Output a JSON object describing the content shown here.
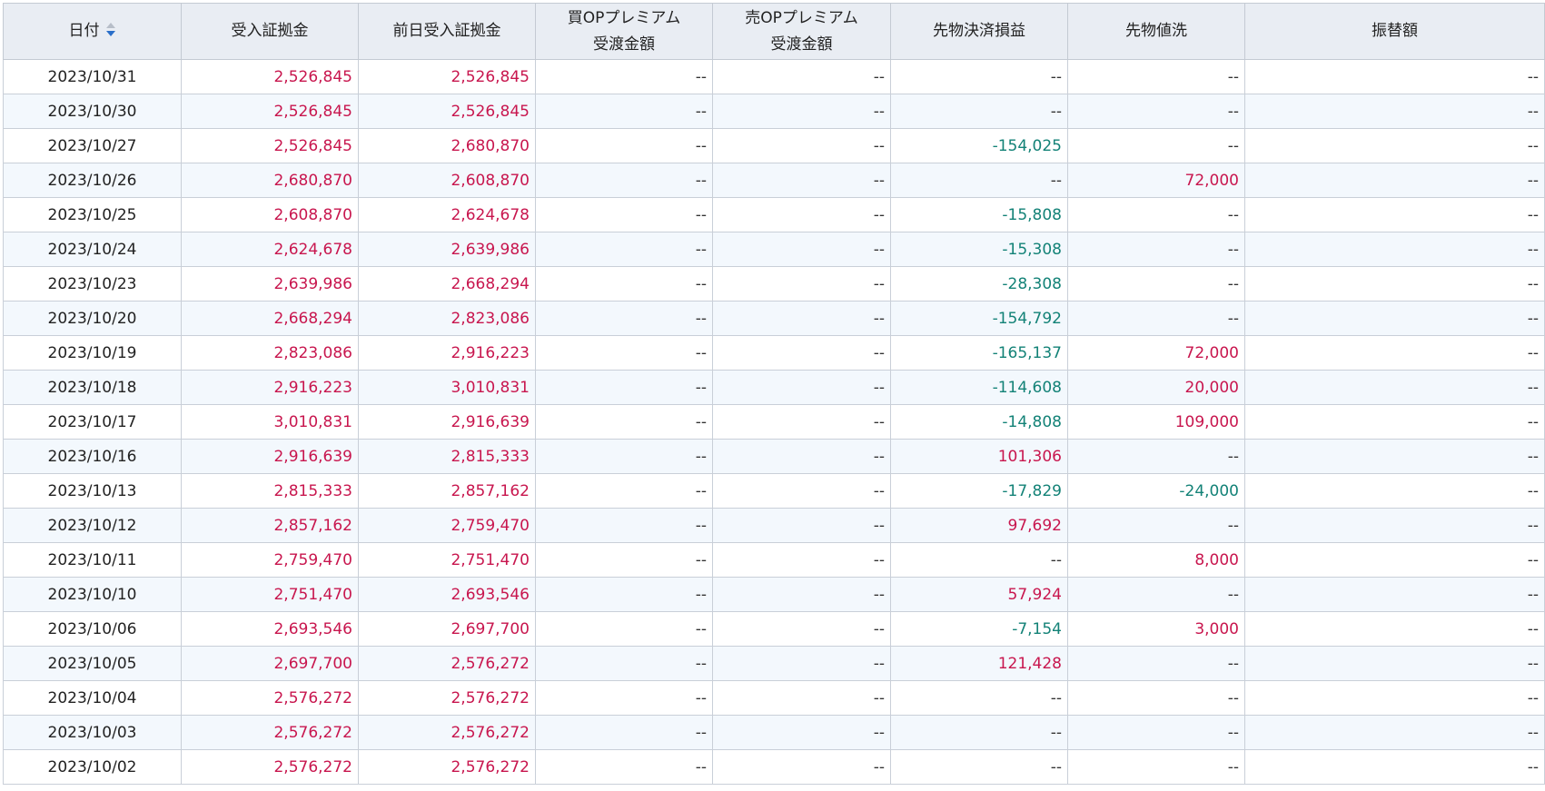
{
  "colors": {
    "positive": "#c8164e",
    "negative": "#138277",
    "header_bg": "#e9edf3",
    "stripe_bg": "#f3f8fd"
  },
  "sort_icon": "sort-descending-icon",
  "columns": [
    {
      "key": "date",
      "line1": "日付",
      "line2": ""
    },
    {
      "key": "margin",
      "line1": "受入証拠金",
      "line2": ""
    },
    {
      "key": "prev_margin",
      "line1": "前日受入証拠金",
      "line2": ""
    },
    {
      "key": "buy_op",
      "line1": "買OPプレミアム",
      "line2": "受渡金額"
    },
    {
      "key": "sell_op",
      "line1": "売OPプレミアム",
      "line2": "受渡金額"
    },
    {
      "key": "futures_pl",
      "line1": "先物決済損益",
      "line2": ""
    },
    {
      "key": "futures_mtm",
      "line1": "先物値洗",
      "line2": ""
    },
    {
      "key": "transfer",
      "line1": "振替額",
      "line2": ""
    }
  ],
  "rows": [
    [
      "2023/10/31",
      "2,526,845",
      "2,526,845",
      "--",
      "--",
      "--",
      "--",
      "--"
    ],
    [
      "2023/10/30",
      "2,526,845",
      "2,526,845",
      "--",
      "--",
      "--",
      "--",
      "--"
    ],
    [
      "2023/10/27",
      "2,526,845",
      "2,680,870",
      "--",
      "--",
      "-154,025",
      "--",
      "--"
    ],
    [
      "2023/10/26",
      "2,680,870",
      "2,608,870",
      "--",
      "--",
      "--",
      "72,000",
      "--"
    ],
    [
      "2023/10/25",
      "2,608,870",
      "2,624,678",
      "--",
      "--",
      "-15,808",
      "--",
      "--"
    ],
    [
      "2023/10/24",
      "2,624,678",
      "2,639,986",
      "--",
      "--",
      "-15,308",
      "--",
      "--"
    ],
    [
      "2023/10/23",
      "2,639,986",
      "2,668,294",
      "--",
      "--",
      "-28,308",
      "--",
      "--"
    ],
    [
      "2023/10/20",
      "2,668,294",
      "2,823,086",
      "--",
      "--",
      "-154,792",
      "--",
      "--"
    ],
    [
      "2023/10/19",
      "2,823,086",
      "2,916,223",
      "--",
      "--",
      "-165,137",
      "72,000",
      "--"
    ],
    [
      "2023/10/18",
      "2,916,223",
      "3,010,831",
      "--",
      "--",
      "-114,608",
      "20,000",
      "--"
    ],
    [
      "2023/10/17",
      "3,010,831",
      "2,916,639",
      "--",
      "--",
      "-14,808",
      "109,000",
      "--"
    ],
    [
      "2023/10/16",
      "2,916,639",
      "2,815,333",
      "--",
      "--",
      "101,306",
      "--",
      "--"
    ],
    [
      "2023/10/13",
      "2,815,333",
      "2,857,162",
      "--",
      "--",
      "-17,829",
      "-24,000",
      "--"
    ],
    [
      "2023/10/12",
      "2,857,162",
      "2,759,470",
      "--",
      "--",
      "97,692",
      "--",
      "--"
    ],
    [
      "2023/10/11",
      "2,759,470",
      "2,751,470",
      "--",
      "--",
      "--",
      "8,000",
      "--"
    ],
    [
      "2023/10/10",
      "2,751,470",
      "2,693,546",
      "--",
      "--",
      "57,924",
      "--",
      "--"
    ],
    [
      "2023/10/06",
      "2,693,546",
      "2,697,700",
      "--",
      "--",
      "-7,154",
      "3,000",
      "--"
    ],
    [
      "2023/10/05",
      "2,697,700",
      "2,576,272",
      "--",
      "--",
      "121,428",
      "--",
      "--"
    ],
    [
      "2023/10/04",
      "2,576,272",
      "2,576,272",
      "--",
      "--",
      "--",
      "--",
      "--"
    ],
    [
      "2023/10/03",
      "2,576,272",
      "2,576,272",
      "--",
      "--",
      "--",
      "--",
      "--"
    ],
    [
      "2023/10/02",
      "2,576,272",
      "2,576,272",
      "--",
      "--",
      "--",
      "--",
      "--"
    ]
  ]
}
